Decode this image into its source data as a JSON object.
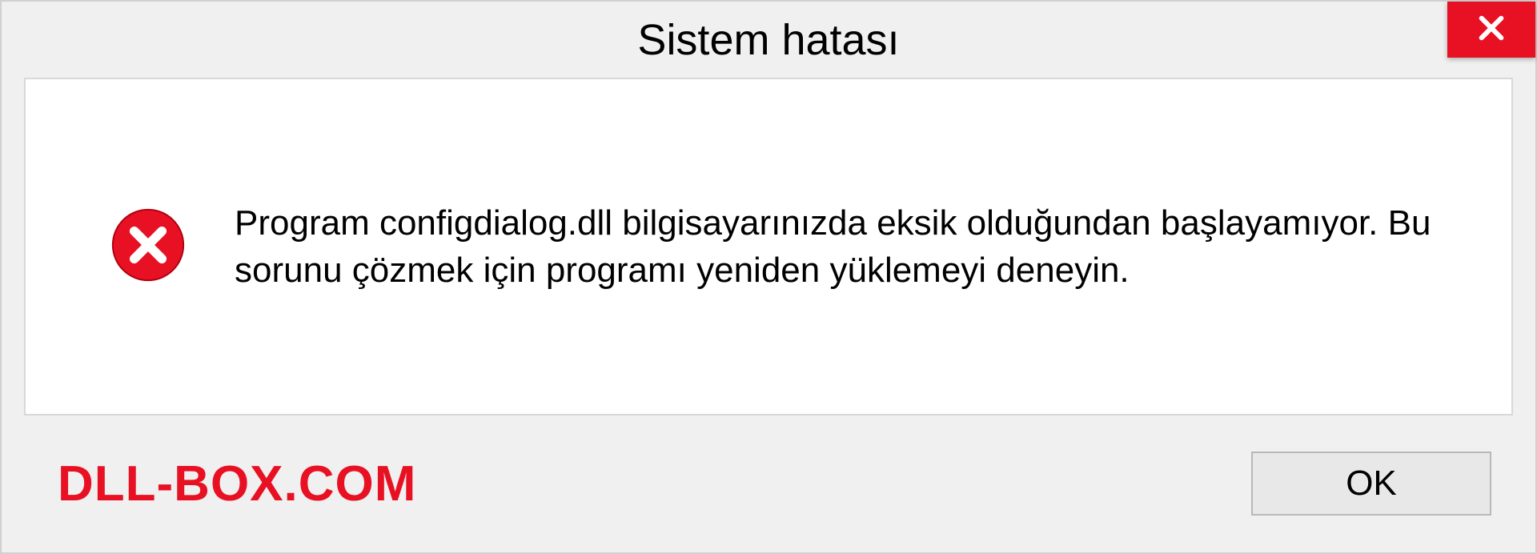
{
  "dialog": {
    "title": "Sistem hatası",
    "message": "Program configdialog.dll bilgisayarınızda eksik olduğundan başlayamıyor. Bu sorunu çözmek için programı yeniden yüklemeyi deneyin.",
    "ok_label": "OK"
  },
  "watermark": "DLL-BOX.COM"
}
